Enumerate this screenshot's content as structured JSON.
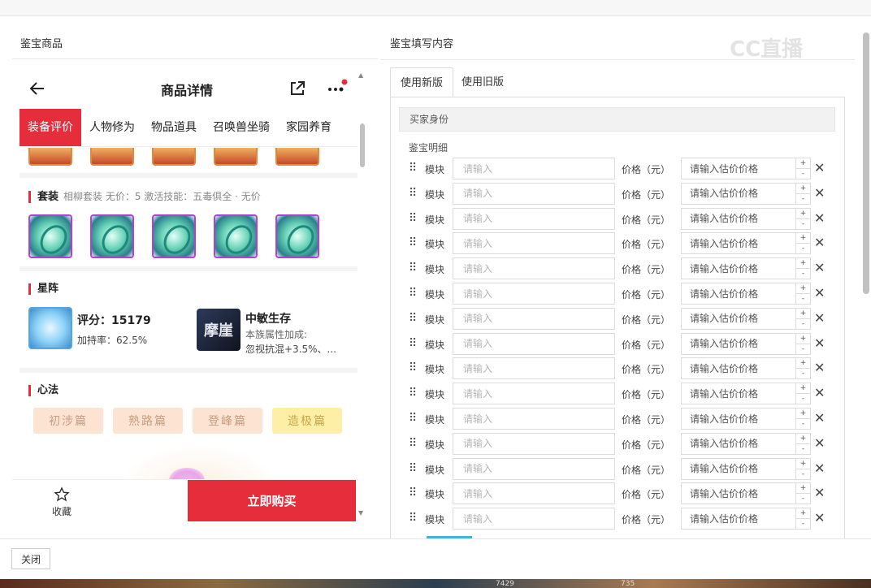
{
  "left_panel": {
    "title": "鉴宝商品"
  },
  "right_panel": {
    "title": "鉴宝填写内容"
  },
  "watermark": "CC直播",
  "phone": {
    "title": "商品详情",
    "tabs": [
      "装备评价",
      "人物修为",
      "物品道具",
      "召唤兽坐骑",
      "家园养育"
    ],
    "active_tab": 0,
    "suit": {
      "title": "套装",
      "meta": "相柳套装  无价：5  激活技能：五毒俱全 · 无价"
    },
    "star_array": {
      "title": "星阵",
      "score_label": "评分：15179",
      "bonus_rate": "加持率：62.5%",
      "card_glyph": "摩崖",
      "card_title": "中敏生存",
      "card_line1": "本族属性加成:",
      "card_line2": "忽视抗混+3.5%、..."
    },
    "xinfa": {
      "title": "心法",
      "items": [
        "初涉篇",
        "熟路篇",
        "登峰篇",
        "造极篇"
      ]
    },
    "favorite_label": "收藏",
    "buy_label": "立即购买"
  },
  "form": {
    "tabs": [
      "使用新版",
      "使用旧版"
    ],
    "active_tab": 0,
    "buyer_section": "买家身份",
    "detail_label": "鉴宝明细",
    "row_label": "模块",
    "row_placeholder": "请输入",
    "price_label": "价格（元）",
    "price_placeholder": "请输入估价价格",
    "rows": 15
  },
  "footer": {
    "close_label": "关闭"
  },
  "taskbar": {
    "num1": "7429",
    "num2": "735"
  },
  "colors": {
    "accent": "#e52d3b",
    "purple_border": "#b53fd0",
    "blue": "#4ab0d8"
  }
}
